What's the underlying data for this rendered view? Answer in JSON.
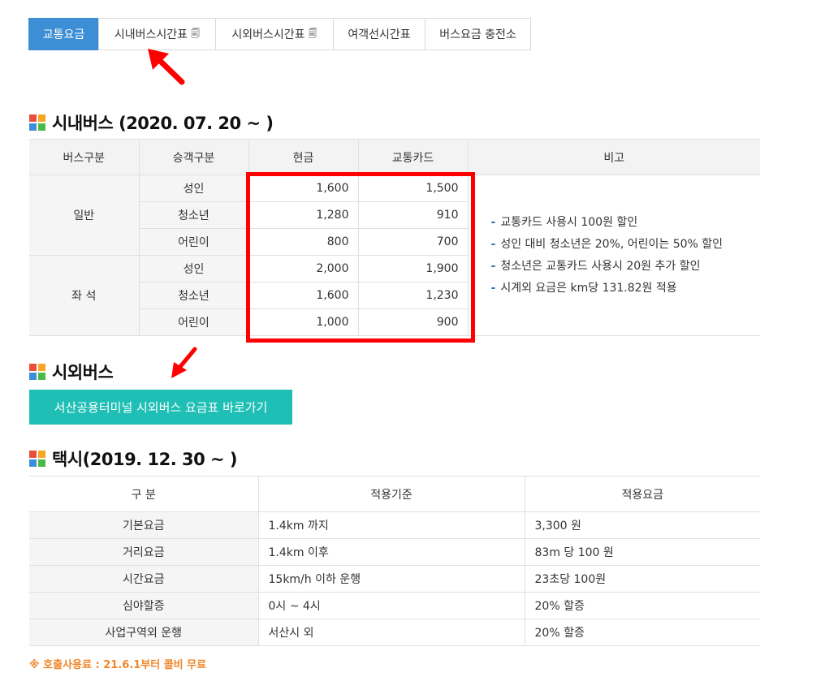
{
  "tabs": [
    {
      "label": "교통요금",
      "active": true,
      "doc": false
    },
    {
      "label": "시내버스시간표",
      "active": false,
      "doc": true
    },
    {
      "label": "시외버스시간표",
      "active": false,
      "doc": true
    },
    {
      "label": "여객선시간표",
      "active": false,
      "doc": false
    },
    {
      "label": "버스요금 충전소",
      "active": false,
      "doc": false
    }
  ],
  "city_bus": {
    "title": "시내버스 (2020. 07. 20 ~ )",
    "headers": [
      "버스구분",
      "승객구분",
      "현금",
      "교통카드",
      "비고"
    ],
    "groups": [
      {
        "name": "일반",
        "rows": [
          {
            "type": "성인",
            "cash": "1,600",
            "card": "1,500"
          },
          {
            "type": "청소년",
            "cash": "1,280",
            "card": "910"
          },
          {
            "type": "어린이",
            "cash": "800",
            "card": "700"
          }
        ]
      },
      {
        "name": "좌 석",
        "rows": [
          {
            "type": "성인",
            "cash": "2,000",
            "card": "1,900"
          },
          {
            "type": "청소년",
            "cash": "1,600",
            "card": "1,230"
          },
          {
            "type": "어린이",
            "cash": "1,000",
            "card": "900"
          }
        ]
      }
    ],
    "notes": [
      "교통카드 사용시 100원 할인",
      "성인 대비 청소년은 20%, 어린이는 50% 할인",
      "청소년은 교통카드 사용시 20원 추가 할인",
      "시계외 요금은 km당 131.82원 적용"
    ]
  },
  "intercity_bus": {
    "title": "시외버스",
    "button_label": "서산공용터미널 시외버스 요금표 바로가기"
  },
  "taxi": {
    "title": "택시(2019. 12. 30 ~ )",
    "headers": [
      "구 분",
      "적용기준",
      "적용요금"
    ],
    "rows": [
      [
        "기본요금",
        "1.4km 까지",
        "3,300 원"
      ],
      [
        "거리요금",
        "1.4km 이후",
        "83m 당 100 원"
      ],
      [
        "시간요금",
        "15km/h 이하 운행",
        "23초당 100원"
      ],
      [
        "심야할증",
        "0시 ~ 4시",
        "20% 할증"
      ],
      [
        "사업구역외 운행",
        "서산시 외",
        "20% 할증"
      ]
    ]
  },
  "footnote": "※ 호출사용료 : 21.6.1부터 콜비 무료",
  "colors": {
    "accent": "#3c8fd4",
    "button": "#1fbfb5",
    "highlight": "#ff0000",
    "footnote": "#f0862a"
  },
  "icon_colors": [
    "#e94e3b",
    "#f6a623",
    "#3a8fd9",
    "#4cb848"
  ]
}
